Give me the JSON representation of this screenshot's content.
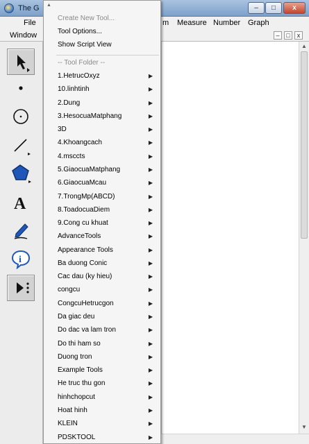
{
  "window": {
    "title": "The G"
  },
  "menubar": {
    "file": "File",
    "partial_edit": "m",
    "measure": "Measure",
    "number": "Number",
    "graph": "Graph",
    "window": "Window"
  },
  "window_controls": {
    "minimize": "–",
    "maximize": "□",
    "close": "x"
  },
  "doc_controls": {
    "minimize": "–",
    "restore": "□",
    "close": "x"
  },
  "tools": [
    {
      "name": "arrow-select-tool",
      "icon": "arrow-icon",
      "active": true
    },
    {
      "name": "point-tool",
      "icon": "point-icon"
    },
    {
      "name": "compass-tool",
      "icon": "circle-icon"
    },
    {
      "name": "straightedge-tool",
      "icon": "segment-icon"
    },
    {
      "name": "polygon-tool",
      "icon": "polygon-icon"
    },
    {
      "name": "text-tool",
      "icon": "text-a-icon"
    },
    {
      "name": "marker-tool",
      "icon": "pen-icon"
    },
    {
      "name": "information-tool",
      "icon": "info-icon"
    },
    {
      "name": "custom-tool",
      "icon": "custom-tool-icon",
      "active": true
    }
  ],
  "dropdown": {
    "create_new_tool": "Create New Tool...",
    "tool_options": "Tool Options...",
    "show_script_view": "Show Script View",
    "tool_folder_header": "-- Tool Folder --",
    "items": [
      "1.HetrucOxyz",
      "10.linhtinh",
      "2.Dung",
      "3.HesocuaMatphang",
      "3D",
      "4.Khoangcach",
      "4.msccts",
      "5.GiaocuaMatphang",
      "6.GiaocuaMcau",
      "7.TrongMp(ABCD)",
      "8.ToadocuaDiem",
      "9.Cong cu khuat",
      "AdvanceTools",
      "Appearance Tools",
      "Ba duong Conic",
      "Cac dau (ky hieu)",
      "congcu",
      "CongcuHetrucgon",
      "Da giac deu",
      "Do dac va lam tron",
      "Do thi ham so",
      "Duong tron",
      "Example Tools",
      "He truc thu gon",
      "hinhchopcut",
      "Hoat hinh",
      "KLEIN",
      "PDSKTOOL"
    ]
  }
}
